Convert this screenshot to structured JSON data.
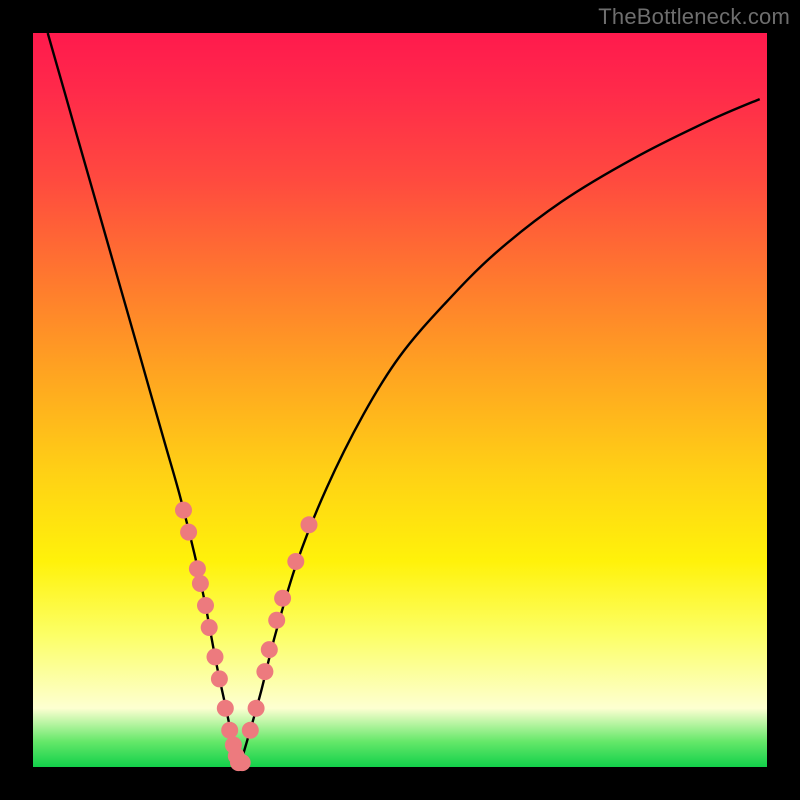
{
  "watermark": "TheBottleneck.com",
  "colors": {
    "curve_stroke": "#000000",
    "dot_fill": "#ed7a7e",
    "dot_stroke": "#d85f63"
  },
  "chart_data": {
    "type": "line",
    "title": "",
    "xlabel": "",
    "ylabel": "",
    "x_range": [
      0,
      100
    ],
    "y_range": [
      0,
      100
    ],
    "series": [
      {
        "name": "bottleneck-curve",
        "x": [
          2,
          4,
          6,
          8,
          10,
          12,
          14,
          16,
          18,
          20,
          22,
          23.5,
          25,
          26.5,
          27.5,
          28,
          29,
          31,
          33,
          36,
          40,
          45,
          50,
          56,
          63,
          72,
          82,
          92,
          99
        ],
        "y": [
          100,
          93,
          86,
          79,
          72,
          65,
          58,
          51,
          44,
          37,
          29,
          22,
          14,
          7,
          2,
          0,
          3,
          10,
          18,
          28,
          38,
          48,
          56,
          63,
          70,
          77,
          83,
          88,
          91
        ]
      }
    ],
    "dots": {
      "name": "sample-points",
      "points": [
        {
          "x": 20.5,
          "y": 35
        },
        {
          "x": 21.2,
          "y": 32
        },
        {
          "x": 22.4,
          "y": 27
        },
        {
          "x": 22.8,
          "y": 25
        },
        {
          "x": 23.5,
          "y": 22
        },
        {
          "x": 24.0,
          "y": 19
        },
        {
          "x": 24.8,
          "y": 15
        },
        {
          "x": 25.4,
          "y": 12
        },
        {
          "x": 26.2,
          "y": 8
        },
        {
          "x": 26.8,
          "y": 5
        },
        {
          "x": 27.3,
          "y": 3
        },
        {
          "x": 27.7,
          "y": 1.5
        },
        {
          "x": 28.0,
          "y": 0.6
        },
        {
          "x": 28.5,
          "y": 0.6
        },
        {
          "x": 29.6,
          "y": 5
        },
        {
          "x": 30.4,
          "y": 8
        },
        {
          "x": 31.6,
          "y": 13
        },
        {
          "x": 32.2,
          "y": 16
        },
        {
          "x": 33.2,
          "y": 20
        },
        {
          "x": 34.0,
          "y": 23
        },
        {
          "x": 35.8,
          "y": 28
        },
        {
          "x": 37.6,
          "y": 33
        }
      ]
    }
  }
}
